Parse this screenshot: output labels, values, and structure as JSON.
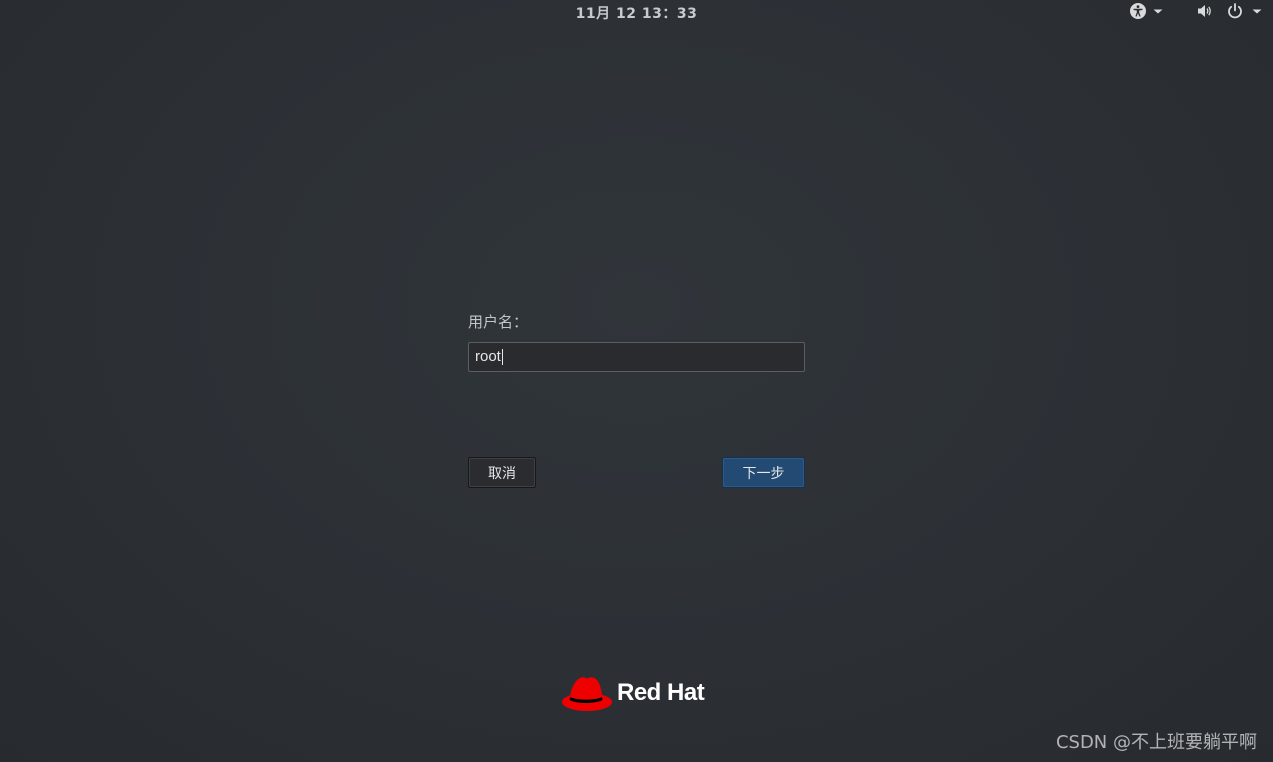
{
  "topbar": {
    "clock": "11月 12  13：33",
    "icons": [
      "accessibility-icon",
      "chevron-down-icon",
      "volume-icon",
      "power-icon",
      "chevron-down-icon"
    ]
  },
  "login": {
    "username_label": "用户名：",
    "username_value": "root",
    "cancel_label": "取消",
    "next_label": "下一步"
  },
  "branding": {
    "logo_text": "Red Hat",
    "logo_color": "#ee0000"
  },
  "watermark": "CSDN @不上班要躺平啊",
  "colors": {
    "background": "#2c3035",
    "next_button": "#234a72",
    "text": "#c3c6c8"
  }
}
